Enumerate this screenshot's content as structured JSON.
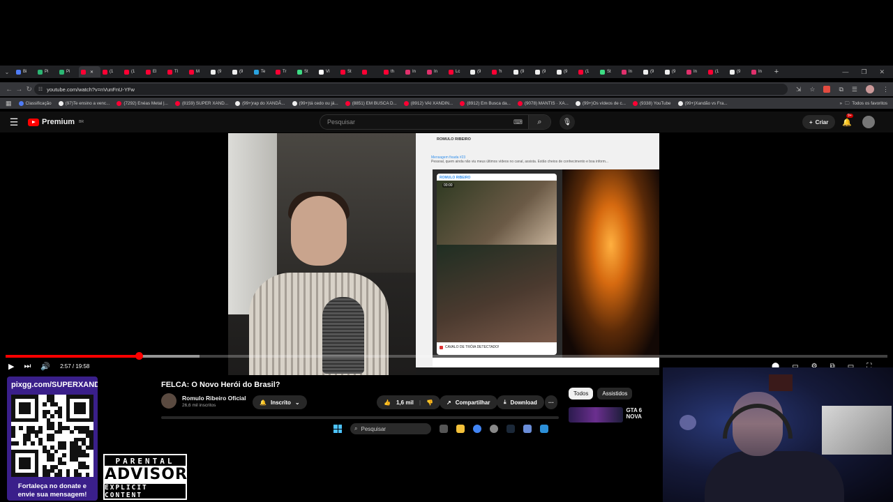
{
  "browser": {
    "tabs": [
      {
        "label": "Bi",
        "color": "#4f7cf6"
      },
      {
        "label": "Pi",
        "color": "#2bb673"
      },
      {
        "label": "Pi",
        "color": "#2bb673"
      },
      {
        "label": "",
        "color": "#ff0033",
        "active": true
      },
      {
        "label": "(1",
        "color": "#ff0033"
      },
      {
        "label": "(1",
        "color": "#ff0033"
      },
      {
        "label": "El",
        "color": "#ff0033"
      },
      {
        "label": "Tl",
        "color": "#ff0033"
      },
      {
        "label": "M",
        "color": "#ff0033"
      },
      {
        "label": "(9",
        "color": "#eeeeee"
      },
      {
        "label": "(9",
        "color": "#eeeeee"
      },
      {
        "label": "Te",
        "color": "#2aa3e0"
      },
      {
        "label": "Tr",
        "color": "#ff0033"
      },
      {
        "label": "St",
        "color": "#3ddc84"
      },
      {
        "label": "VI",
        "color": "#ffffff"
      },
      {
        "label": "St",
        "color": "#ff0033"
      },
      {
        "label": "",
        "color": "#ff0033"
      },
      {
        "label": "th",
        "color": "#ff0033"
      },
      {
        "label": "In",
        "color": "#e1306c"
      },
      {
        "label": "In",
        "color": "#e1306c"
      },
      {
        "label": "Lc",
        "color": "#ff0033"
      },
      {
        "label": "(9",
        "color": "#eeeeee"
      },
      {
        "label": "'h",
        "color": "#ff0033"
      },
      {
        "label": "(9",
        "color": "#eeeeee"
      },
      {
        "label": "(9",
        "color": "#eeeeee"
      },
      {
        "label": "(9",
        "color": "#eeeeee"
      },
      {
        "label": "(1",
        "color": "#ff0033"
      },
      {
        "label": "St",
        "color": "#3ddc84"
      },
      {
        "label": "In",
        "color": "#e1306c"
      },
      {
        "label": "(9",
        "color": "#eeeeee"
      },
      {
        "label": "(9",
        "color": "#eeeeee"
      },
      {
        "label": "In",
        "color": "#e1306c"
      },
      {
        "label": "(1",
        "color": "#ff0033"
      },
      {
        "label": "(9",
        "color": "#eeeeee"
      },
      {
        "label": "In",
        "color": "#e1306c"
      }
    ],
    "new_tab": "+",
    "url": "youtube.com/watch?v=nVunFnU-YFw",
    "bookmarks": [
      {
        "label": "Classificação",
        "color": "#4f7cf6"
      },
      {
        "label": "(97)Te ensino a venc...",
        "color": "#eeeeee"
      },
      {
        "label": "(7292) Enéas Metal |...",
        "color": "#ff0033"
      },
      {
        "label": "(8159) SUPER XAND...",
        "color": "#ff0033"
      },
      {
        "label": "(99+)rap do XANDÃ...",
        "color": "#eeeeee"
      },
      {
        "label": "(99+)tá cedo ou já...",
        "color": "#eeeeee"
      },
      {
        "label": "(8851) EM BUSCA D...",
        "color": "#ff0033"
      },
      {
        "label": "(8912) VAI XANDIN...",
        "color": "#ff0033"
      },
      {
        "label": "(8912) Em Busca da...",
        "color": "#ff0033"
      },
      {
        "label": "(9078) MANTIS · XA...",
        "color": "#ff0033"
      },
      {
        "label": "(99+)Os vídeos de c...",
        "color": "#eeeeee"
      },
      {
        "label": "(9338) YouTube",
        "color": "#ff0033"
      },
      {
        "label": "(99+)Xandão vs Fra...",
        "color": "#eeeeee"
      }
    ],
    "all_bookmarks": "Todos os favoritos"
  },
  "youtube": {
    "logo": "Premium",
    "logo_region": "BR",
    "search_placeholder": "Pesquisar",
    "create_label": "Criar",
    "notif_badge": "9+"
  },
  "video": {
    "progress_fraction": 0.151,
    "buffer_fraction": 0.22,
    "time": "2:57 / 19:58",
    "telegram": {
      "channel": "ROMULO RIBEIRO",
      "pinned_title": "Mensagem fixada #23",
      "pinned_text": "Pessoal, quem ainda não viu meus últimos vídeos no canal, assista. Estão cheios de conhecimento e boa inform...",
      "card_from": "ROMULO RIBEIRO",
      "card_time": "00:00",
      "caption": "CAVALO DE TRÓIA DETECTADO!"
    }
  },
  "details": {
    "title": "FELCA: O Novo Herói do Brasil?",
    "channel": "Romulo Ribeiro Oficial",
    "subscribers": "26,6 mil inscritos",
    "subscribed_label": "Inscrito",
    "likes": "1,6 mil",
    "share_label": "Compartilhar",
    "download_label": "Download",
    "more_label": "···"
  },
  "sidebar": {
    "chips": [
      "Todos",
      "Assistidos"
    ],
    "rec_title": "GTA 6 NOVA"
  },
  "overlay": {
    "qr_url": "pixgg.com/SUPERXANDÃO",
    "qr_message": "Fortaleça no donate e envie sua mensagem!",
    "advisory_top": "PARENTAL",
    "advisory_mid": "ADVISORY",
    "advisory_bottom": "EXPLICIT CONTENT"
  },
  "taskbar": {
    "search_label": "Pesquisar"
  }
}
